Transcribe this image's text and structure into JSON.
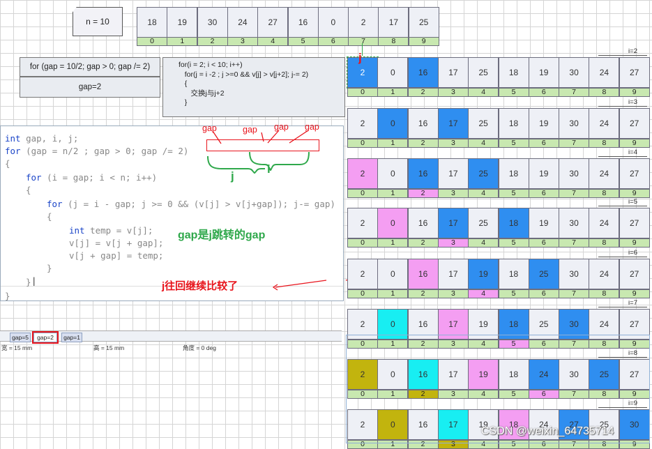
{
  "n_box": {
    "label": "n = 10"
  },
  "top_array": {
    "values": [
      "18",
      "19",
      "30",
      "24",
      "27",
      "16",
      "0",
      "2",
      "17",
      "25"
    ],
    "indices": [
      "0",
      "1",
      "2",
      "3",
      "4",
      "5",
      "6",
      "7",
      "8",
      "9"
    ]
  },
  "loop_box": {
    "label": "for (gap = 10/2; gap > 0; gap /= 2)"
  },
  "gap_box": {
    "label": "gap=2"
  },
  "inner_code": {
    "lines": [
      "for(i = 2; i < 10; i++)",
      "   for(j = i -2 ; j >=0 && v[j] > v[j+2]; j-= 2)",
      "   {",
      "      交换j与j+2",
      "   }"
    ]
  },
  "editor": {
    "lines": [
      {
        "kw": "int",
        "rest": " gap, i, j;"
      },
      {
        "kw": "for",
        "rest": " (gap = n/2 ; gap > 0; gap /= 2)"
      },
      {
        "kw": "",
        "rest": "{"
      },
      {
        "kw": "for",
        "rest": " (i = gap; i < n; i++)"
      },
      {
        "kw": "",
        "rest": "{"
      },
      {
        "kw": "for",
        "rest": " (j = i - gap; j >= 0 && (v[j] > v[j+gap]); j-= gap)"
      },
      {
        "kw": "",
        "rest": "{"
      },
      {
        "kw": "int",
        "rest": " temp = v[j];"
      },
      {
        "kw": "",
        "rest": "v[j] = v[j + gap];"
      },
      {
        "kw": "",
        "rest": "v[j + gap] = temp;"
      },
      {
        "kw": "",
        "rest": "}"
      },
      {
        "kw": "",
        "rest": "}"
      },
      {
        "kw": "",
        "rest": "}"
      }
    ]
  },
  "annotations": {
    "gap1": "gap",
    "gap2": "gap",
    "gap3": "gap",
    "gap4": "gap",
    "j_label": "j",
    "i_label": "i",
    "gap_note": "gap是j跳转的gap",
    "back_note": "j往回继续比较了",
    "j_marker": "j"
  },
  "tabs": [
    "gap=5",
    "gap=2",
    "gap=1"
  ],
  "status": {
    "width": "宽 = 15 mm",
    "height": "高 = 15 mm",
    "angle": "角度 = 0 deg"
  },
  "watermark": "CSDN @weixin_64735714",
  "colors": {
    "blue": "#2f8ef0",
    "pink": "#f49ef2",
    "cyan": "#18eef2",
    "olive": "#c2b40e",
    "red": "#e8141c",
    "green": "#2fa84b"
  },
  "rows": [
    {
      "label": "i=2",
      "values": [
        "2",
        "0",
        "16",
        "17",
        "25",
        "18",
        "19",
        "30",
        "24",
        "27"
      ],
      "colors": [
        "sel",
        "none",
        "blue",
        "",
        "",
        "",
        "",
        "",
        "",
        ""
      ],
      "idxcolors": [
        "",
        "",
        "",
        "",
        "",
        "",
        "",
        "",
        "",
        ""
      ]
    },
    {
      "label": "i=3",
      "values": [
        "2",
        "0",
        "16",
        "17",
        "25",
        "18",
        "19",
        "30",
        "24",
        "27"
      ],
      "colors": [
        "",
        "blue",
        "",
        "blue",
        "",
        "",
        "",
        "",
        "",
        ""
      ],
      "idxcolors": [
        "",
        "",
        "",
        "",
        "",
        "",
        "",
        "",
        "",
        ""
      ]
    },
    {
      "label": "i=4",
      "values": [
        "2",
        "0",
        "16",
        "17",
        "25",
        "18",
        "19",
        "30",
        "24",
        "27"
      ],
      "colors": [
        "pink",
        "",
        "blue",
        "",
        "blue",
        "",
        "",
        "",
        "",
        ""
      ],
      "idxcolors": [
        "",
        "",
        "pink",
        "",
        "",
        "",
        "",
        "",
        "",
        ""
      ]
    },
    {
      "label": "i=5",
      "values": [
        "2",
        "0",
        "16",
        "17",
        "25",
        "18",
        "19",
        "30",
        "24",
        "27"
      ],
      "colors": [
        "",
        "pink",
        "",
        "blue",
        "",
        "blue",
        "",
        "",
        "",
        ""
      ],
      "idxcolors": [
        "",
        "",
        "",
        "pink",
        "",
        "",
        "",
        "",
        "",
        ""
      ]
    },
    {
      "label": "i=6",
      "values": [
        "2",
        "0",
        "16",
        "17",
        "19",
        "18",
        "25",
        "30",
        "24",
        "27"
      ],
      "colors": [
        "",
        "",
        "pink",
        "",
        "blue",
        "",
        "blue",
        "",
        "",
        ""
      ],
      "idxcolors": [
        "",
        "",
        "",
        "",
        "pink",
        "",
        "",
        "",
        "",
        ""
      ]
    },
    {
      "label": "i=7",
      "values": [
        "2",
        "0",
        "16",
        "17",
        "19",
        "18",
        "25",
        "30",
        "24",
        "27"
      ],
      "colors": [
        "",
        "cyan",
        "",
        "pink",
        "",
        "blue",
        "",
        "blue",
        "",
        ""
      ],
      "idxcolors": [
        "",
        "",
        "",
        "",
        "",
        "pink",
        "",
        "",
        "",
        ""
      ]
    },
    {
      "label": "i=8",
      "values": [
        "2",
        "0",
        "16",
        "17",
        "19",
        "18",
        "24",
        "30",
        "25",
        "27"
      ],
      "colors": [
        "olive",
        "",
        "cyan",
        "",
        "pink",
        "",
        "blue",
        "",
        "blue",
        ""
      ],
      "idxcolors": [
        "",
        "",
        "olive",
        "",
        "",
        "",
        "pink",
        "",
        "",
        ""
      ]
    },
    {
      "label": "i=9",
      "values": [
        "2",
        "0",
        "16",
        "17",
        "19",
        "18",
        "24",
        "27",
        "25",
        "30"
      ],
      "colors": [
        "",
        "olive",
        "",
        "cyan",
        "",
        "pink",
        "",
        "blue",
        "",
        "blue"
      ],
      "idxcolors": [
        "",
        "",
        "",
        "olive",
        "",
        "",
        "",
        "",
        "",
        ""
      ]
    }
  ]
}
